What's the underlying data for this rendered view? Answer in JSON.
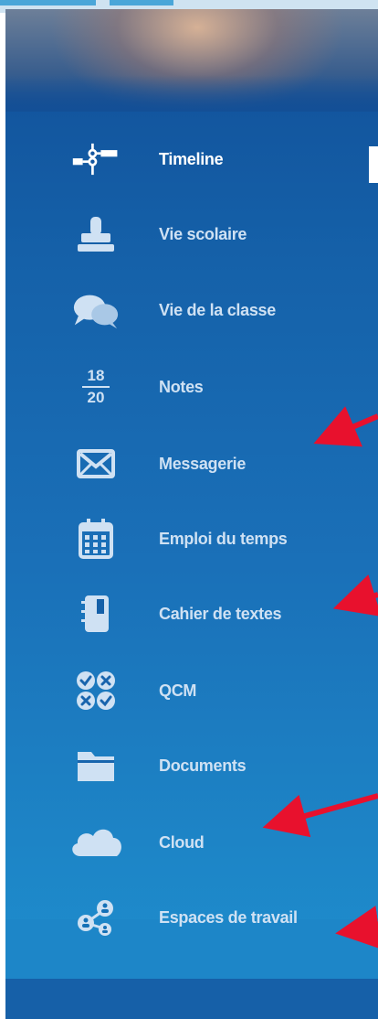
{
  "sidebar": {
    "items": [
      {
        "label": "Timeline",
        "icon": "timeline-icon",
        "active": true
      },
      {
        "label": "Vie scolaire",
        "icon": "stamp-icon"
      },
      {
        "label": "Vie de la classe",
        "icon": "chat-bubbles-icon"
      },
      {
        "label": "Notes",
        "icon": "grade-fraction-icon",
        "numerator": "18",
        "denominator": "20"
      },
      {
        "label": "Messagerie",
        "icon": "envelope-icon"
      },
      {
        "label": "Emploi du temps",
        "icon": "calendar-icon"
      },
      {
        "label": "Cahier de textes",
        "icon": "notebook-icon"
      },
      {
        "label": "QCM",
        "icon": "quiz-icon"
      },
      {
        "label": "Documents",
        "icon": "folder-icon"
      },
      {
        "label": "Cloud",
        "icon": "cloud-icon"
      },
      {
        "label": "Espaces de travail",
        "icon": "workspaces-icon"
      }
    ]
  },
  "colors": {
    "panel_top": "#114f98",
    "panel_bottom": "#1e90cf",
    "label": "#cfe1f3",
    "active_label": "#ffffff",
    "annotation_arrow": "#e8112d"
  },
  "annotations": [
    {
      "points_to": "Messagerie"
    },
    {
      "points_to": "Cahier de textes"
    },
    {
      "points_to": "Cloud"
    },
    {
      "points_to": "Espaces de travail"
    }
  ]
}
